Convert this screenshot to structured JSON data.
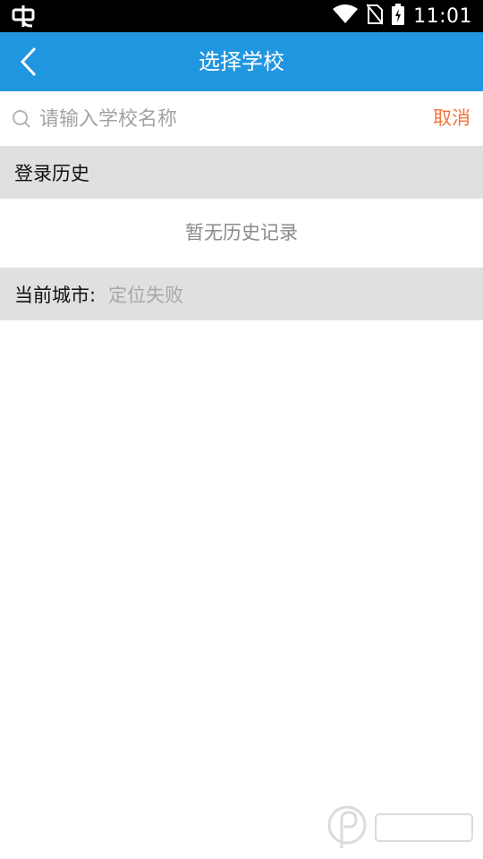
{
  "status_bar": {
    "time": "11:01",
    "left_icon": "app-notification-icon",
    "icons": [
      "wifi-icon",
      "no-sim-icon",
      "battery-charging-icon"
    ]
  },
  "app_bar": {
    "title": "选择学校",
    "back_icon": "back-chevron-icon",
    "background_color": "#2196e0"
  },
  "search": {
    "placeholder": "请输入学校名称",
    "value": "",
    "cancel_label": "取消",
    "cancel_color": "#f0743b"
  },
  "history": {
    "header": "登录历史",
    "empty_text": "暂无历史记录"
  },
  "city": {
    "label": "当前城市:",
    "value": "定位失败"
  },
  "colors": {
    "section_bg": "#e0e0e0",
    "muted_text": "#a8a8a8"
  }
}
